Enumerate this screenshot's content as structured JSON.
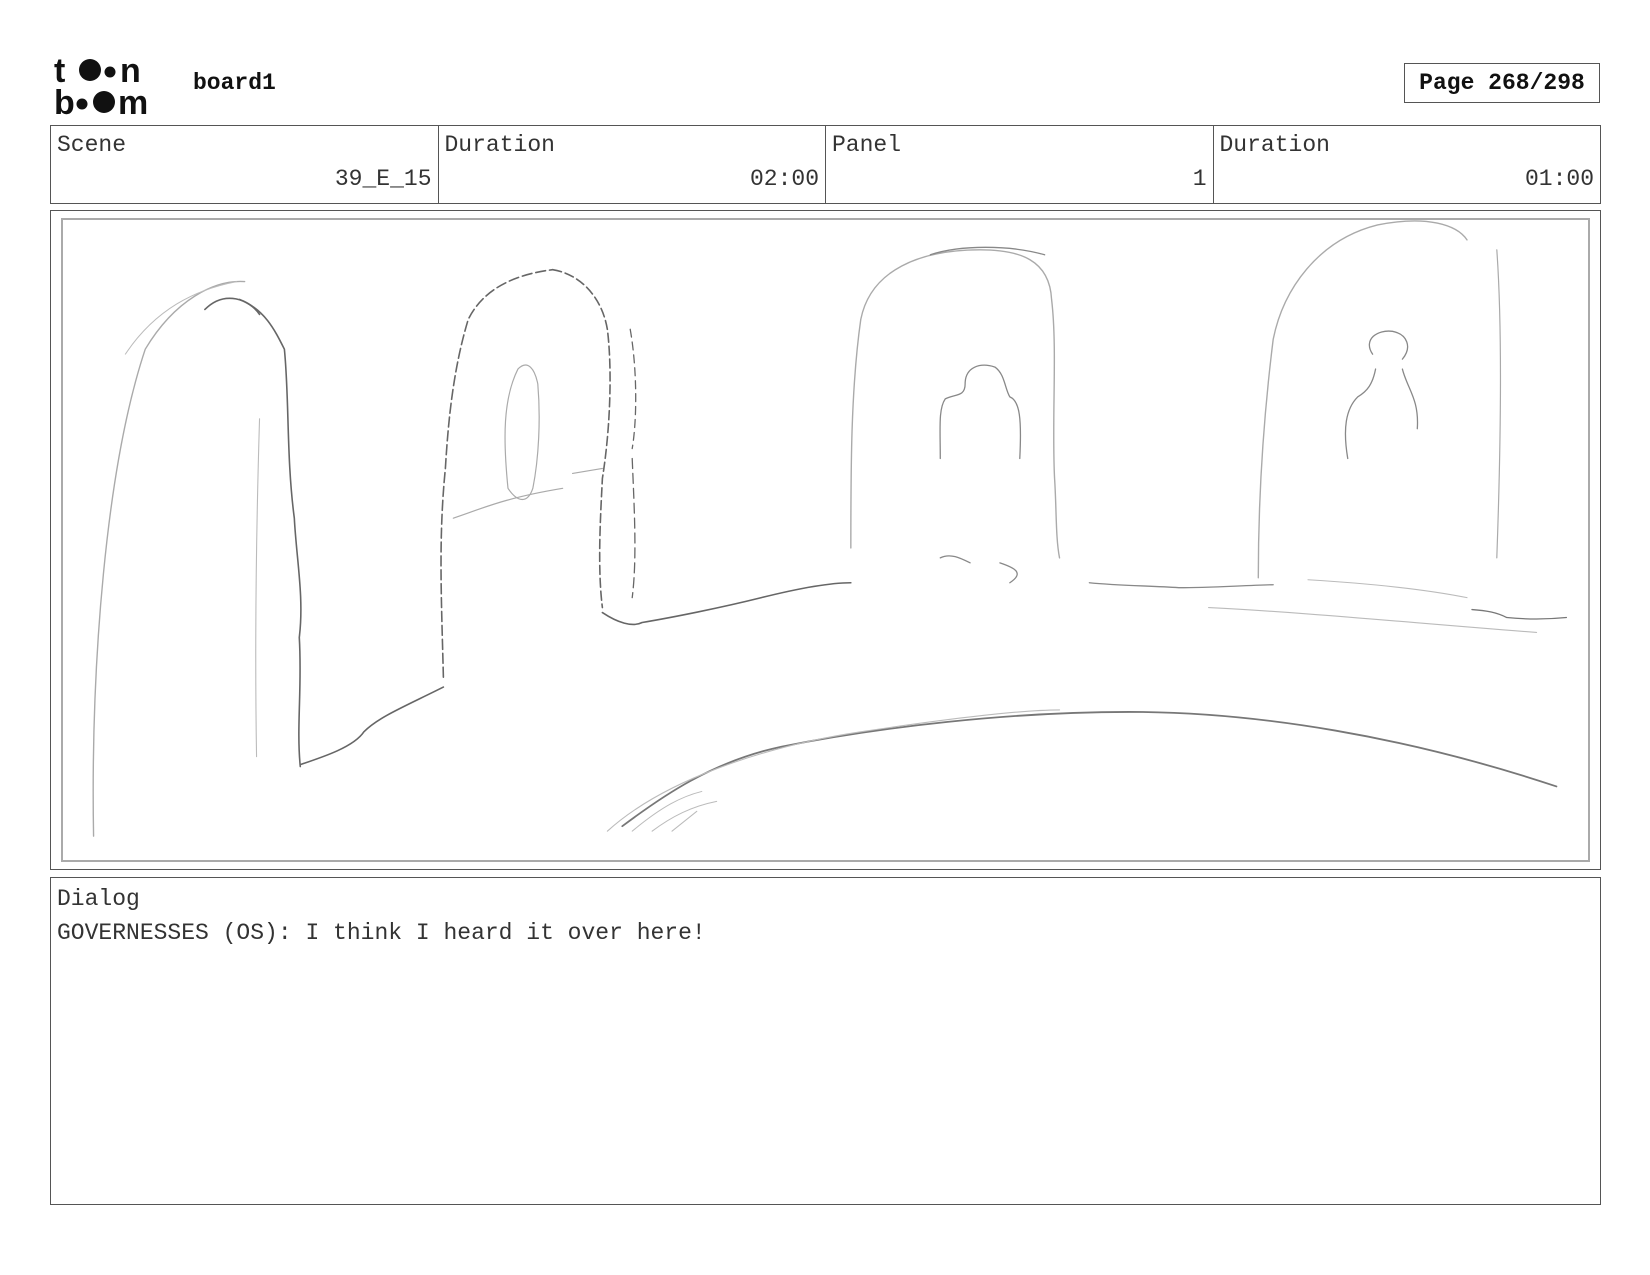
{
  "header": {
    "logo_name": "toonboom-logo",
    "logo_text": "toon boom",
    "board_name": "board1",
    "page_label": "Page 268/298"
  },
  "info": {
    "scene_label": "Scene",
    "scene_value": "39_E_15",
    "scene_duration_label": "Duration",
    "scene_duration_value": "02:00",
    "panel_label": "Panel",
    "panel_value": "1",
    "panel_duration_label": "Duration",
    "panel_duration_value": "01:00"
  },
  "panel": {
    "image": "pencil-sketch-arches"
  },
  "dialog": {
    "label": "Dialog",
    "text": "GOVERNESSES (OS): I think I heard it over here!"
  }
}
